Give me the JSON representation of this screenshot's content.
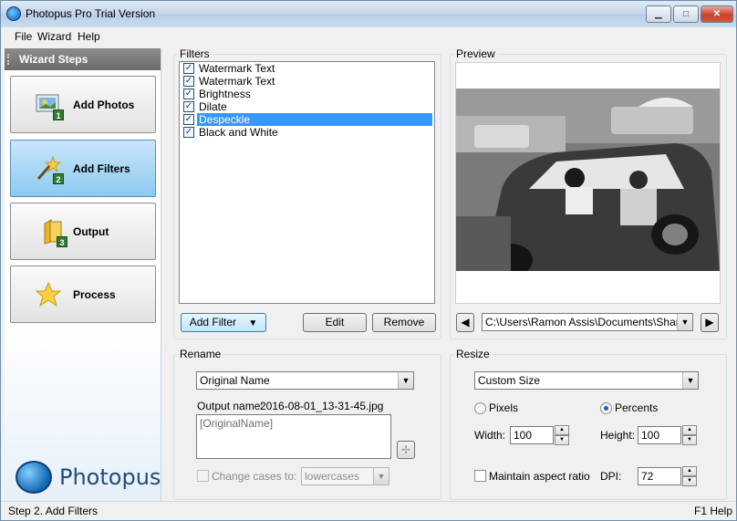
{
  "window": {
    "title": "Photopus Pro Trial Version",
    "min_glyph": "▁",
    "max_glyph": "□",
    "close_glyph": "✕"
  },
  "menu": {
    "items": [
      "File",
      "Wizard",
      "Help"
    ]
  },
  "sidebar": {
    "header": "Wizard Steps",
    "steps": [
      {
        "label": "Add Photos",
        "num": "1",
        "icon": "photo-icon"
      },
      {
        "label": "Add Filters",
        "num": "2",
        "icon": "magic-wand-icon"
      },
      {
        "label": "Output",
        "num": "3",
        "icon": "folder-icon"
      },
      {
        "label": "Process",
        "num": "",
        "icon": "star-icon"
      }
    ],
    "brand": "Photopus"
  },
  "filters": {
    "title": "Filters",
    "items": [
      {
        "label": "Watermark Text",
        "checked": true,
        "selected": false
      },
      {
        "label": "Watermark Text",
        "checked": true,
        "selected": false
      },
      {
        "label": "Brightness",
        "checked": true,
        "selected": false
      },
      {
        "label": "Dilate",
        "checked": true,
        "selected": false
      },
      {
        "label": "Despeckle",
        "checked": true,
        "selected": true
      },
      {
        "label": "Black and White",
        "checked": true,
        "selected": false
      }
    ],
    "add_filter": "Add Filter",
    "edit": "Edit",
    "remove": "Remove"
  },
  "preview": {
    "title": "Preview",
    "path": "C:\\Users\\Ramon Assis\\Documents\\ShareX",
    "prev_glyph": "◀",
    "next_glyph": "▶"
  },
  "rename": {
    "title": "Rename",
    "mode": "Original Name",
    "output_name_label": "Output name:",
    "output_name_value": "2016-08-01_13-31-45.jpg",
    "template": "[OriginalName]",
    "insert_glyph": "✢",
    "change_cases_label": "Change cases to:",
    "case_value": "lowercases"
  },
  "resize": {
    "title": "Resize",
    "mode": "Custom Size",
    "pixels_label": "Pixels",
    "percents_label": "Percents",
    "unit_selected": "Percents",
    "width_label": "Width:",
    "width_value": "100",
    "height_label": "Height:",
    "height_value": "100",
    "aspect_label": "Maintain aspect ratio",
    "dpi_label": "DPI:",
    "dpi_value": "72"
  },
  "status": {
    "left": "Step 2. Add Filters",
    "right": "F1 Help"
  }
}
